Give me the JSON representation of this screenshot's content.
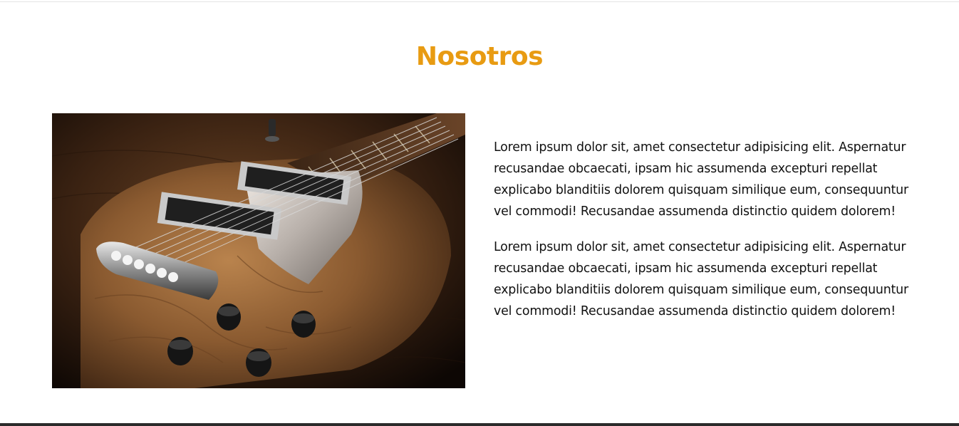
{
  "about": {
    "title": "Nosotros",
    "paragraphs": [
      "Lorem ipsum dolor sit, amet consectetur adipisicing elit. Aspernatur recusandae obcaecati, ipsam hic assumenda excepturi repellat explicabo blanditiis dolorem quisquam similique eum, consequuntur vel commodi! Recusandae assumenda distinctio quidem dolorem!",
      "Lorem ipsum dolor sit, amet consectetur adipisicing elit. Aspernatur recusandae obcaecati, ipsam hic assumenda excepturi repellat explicabo blanditiis dolorem quisquam similique eum, consequuntur vel commodi! Recusandae assumenda distinctio quidem dolorem!"
    ],
    "image_subject": "electric-guitar-photo"
  },
  "colors": {
    "accent": "#e89b12",
    "text": "#111111",
    "background": "#ffffff",
    "footer_bar": "#2b2b2b"
  }
}
